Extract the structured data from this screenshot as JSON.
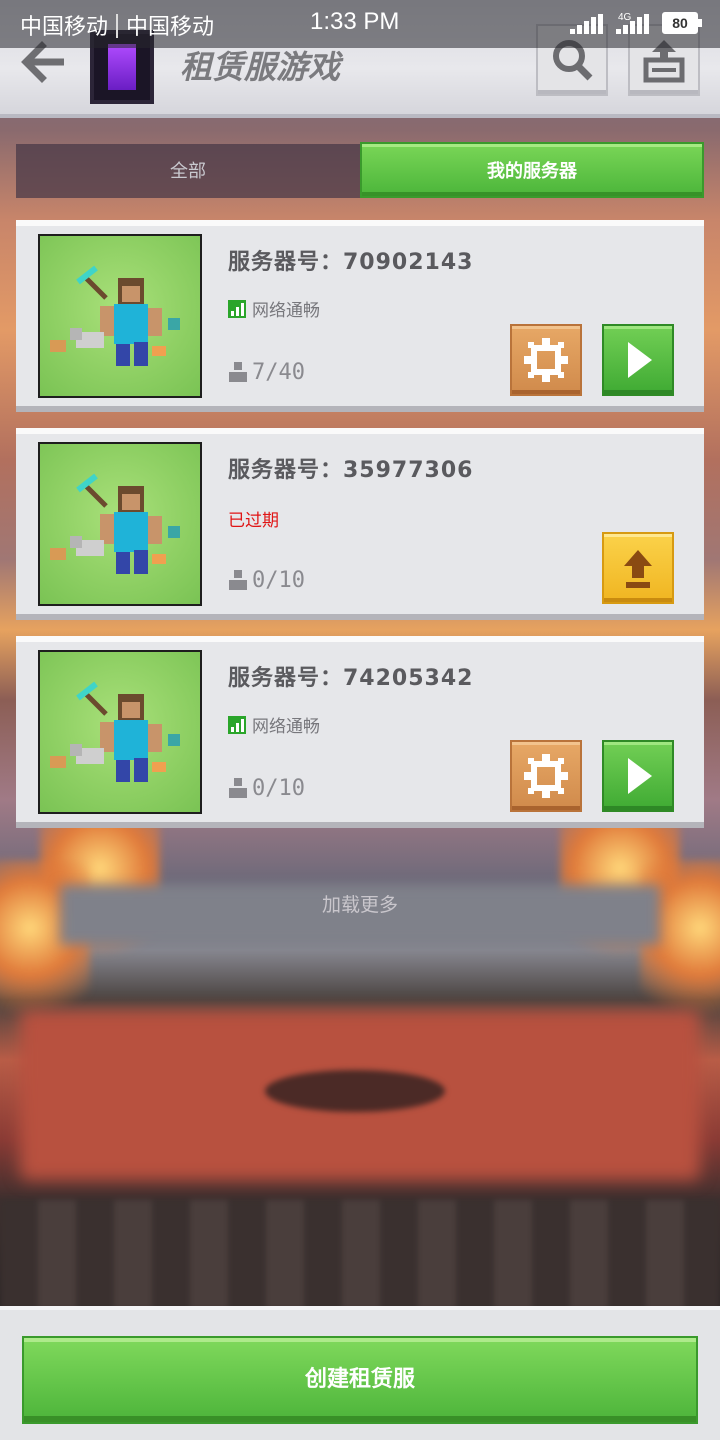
{
  "status_bar": {
    "carrier1": "中国移动",
    "carrier2": "中国移动",
    "time": "1:33 PM",
    "network_label": "4G",
    "battery": "80"
  },
  "header": {
    "title": "租赁服游戏",
    "back_icon": "arrow-left-icon",
    "search_icon": "search-icon",
    "share_icon": "upload-icon"
  },
  "tabs": [
    {
      "label": "全部",
      "active": false
    },
    {
      "label": "我的服务器",
      "active": true
    }
  ],
  "servers": [
    {
      "id_label": "服务器号：70902143",
      "status": "网络通畅",
      "status_type": "ok",
      "players": "7/40",
      "actions": [
        "settings",
        "play"
      ]
    },
    {
      "id_label": "服务器号：35977306",
      "status": "已过期",
      "status_type": "expired",
      "players": "0/10",
      "actions": [
        "upgrade"
      ]
    },
    {
      "id_label": "服务器号：74205342",
      "status": "网络通畅",
      "status_type": "ok",
      "players": "0/10",
      "actions": [
        "settings",
        "play"
      ]
    }
  ],
  "load_more": "加载更多",
  "footer": {
    "create_label": "创建租赁服"
  },
  "colors": {
    "accent_green": "#4bb53a",
    "expired_red": "#e01515",
    "settings_orange": "#d08a4b",
    "upgrade_yellow": "#f0b521"
  }
}
